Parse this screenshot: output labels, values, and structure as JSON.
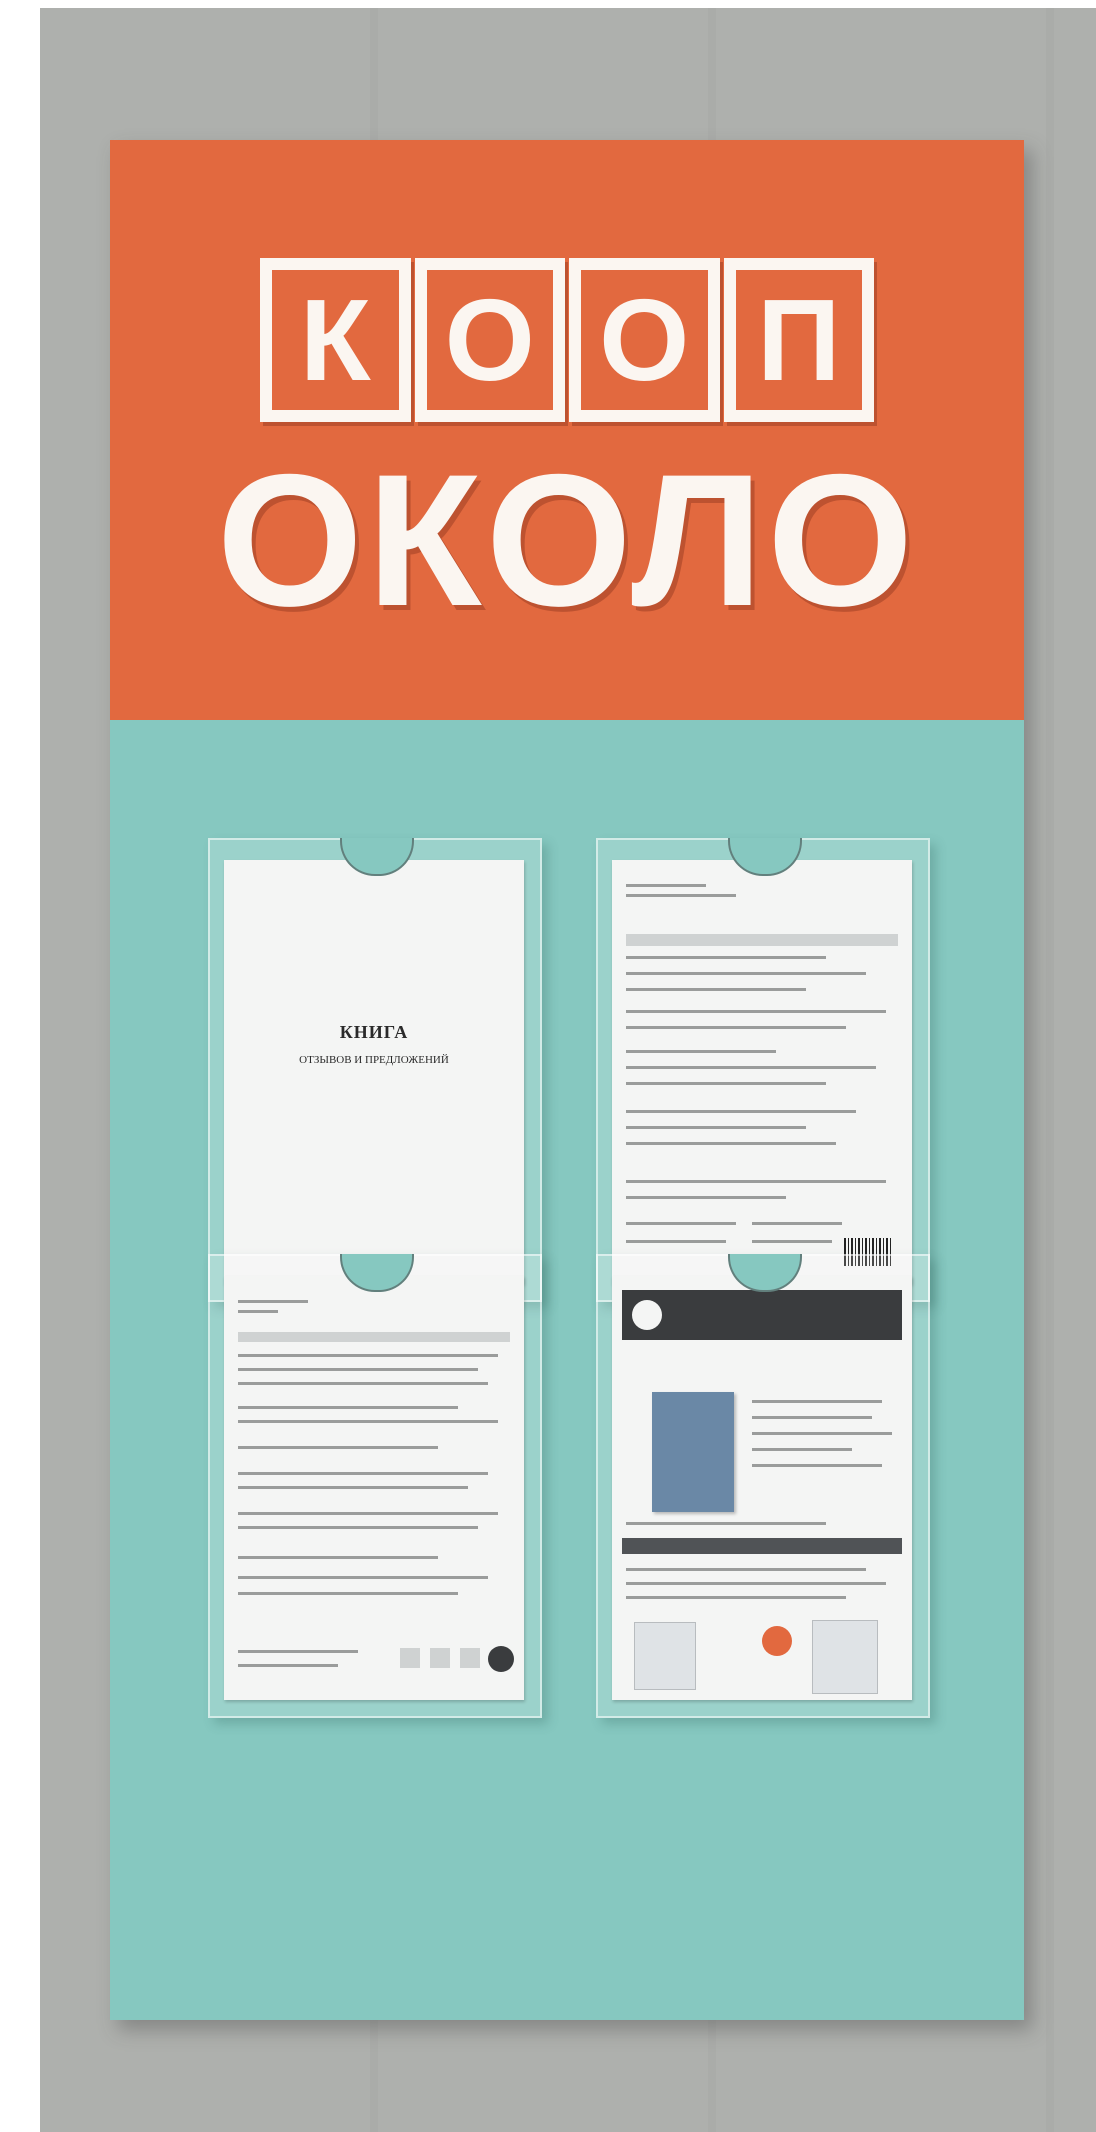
{
  "logo": {
    "letters": [
      "К",
      "О",
      "О",
      "П"
    ]
  },
  "brand_name": "ОКОЛО",
  "documents": {
    "book_title": "КНИГА",
    "book_subtitle": "ОТЗЫВОВ И ПРЕДЛОЖЕНИЙ"
  },
  "colors": {
    "orange": "#e2693f",
    "turquoise": "#86c8c0",
    "brick": "#c9cac7",
    "sign_text": "#fbf6f1"
  }
}
